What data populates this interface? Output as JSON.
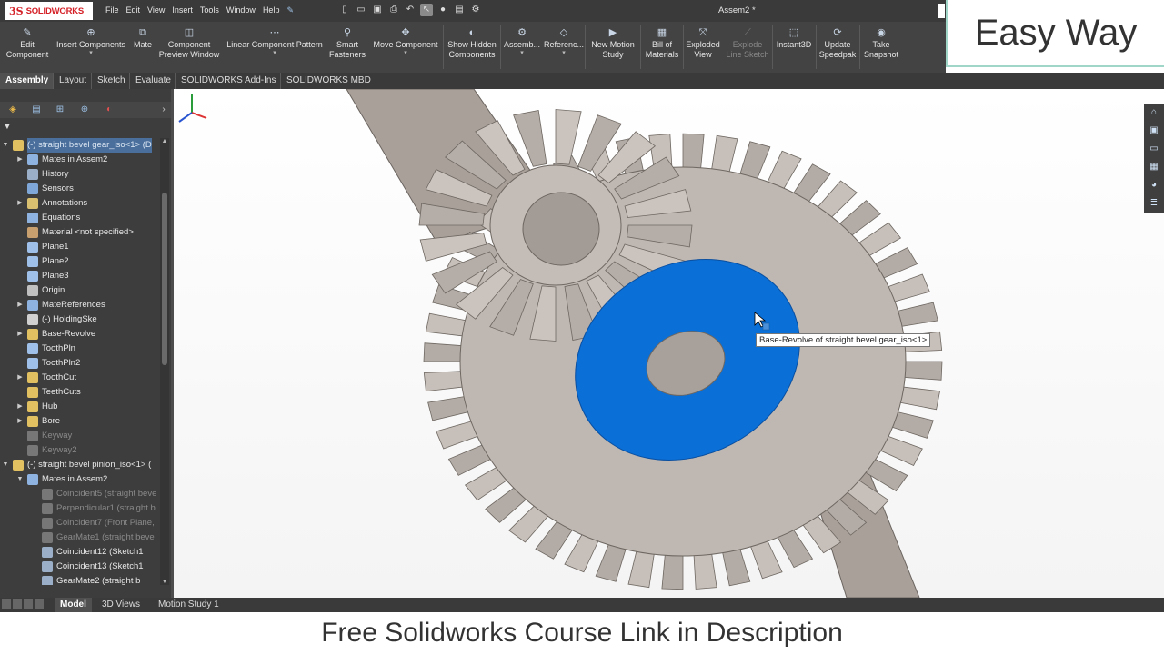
{
  "app": {
    "logo_ds": "3S",
    "logo_name": "SOLIDWORKS",
    "menu": [
      "File",
      "Edit",
      "View",
      "Insert",
      "Tools",
      "Window",
      "Help"
    ],
    "document_title": "Assem2 *"
  },
  "overlay": {
    "brand_text": "Easy Way",
    "caption": "Free Solidworks Course Link in Description"
  },
  "ribbon": {
    "buttons": [
      {
        "label": "Edit\nComponent",
        "icon": "edit-component-icon"
      },
      {
        "label": "Insert Components",
        "icon": "insert-components-icon"
      },
      {
        "label": "Mate",
        "icon": "mate-icon"
      },
      {
        "label": "Component\nPreview Window",
        "icon": "preview-window-icon"
      },
      {
        "label": "Linear Component Pattern",
        "icon": "linear-pattern-icon"
      },
      {
        "label": "Smart\nFasteners",
        "icon": "smart-fasteners-icon"
      },
      {
        "label": "Move Component",
        "icon": "move-component-icon"
      },
      {
        "label": "Show Hidden\nComponents",
        "icon": "show-hidden-icon"
      },
      {
        "label": "Assemb...",
        "icon": "assembly-features-icon"
      },
      {
        "label": "Referenc...",
        "icon": "reference-geometry-icon"
      },
      {
        "label": "New Motion\nStudy",
        "icon": "motion-study-icon"
      },
      {
        "label": "Bill of\nMaterials",
        "icon": "bom-icon"
      },
      {
        "label": "Exploded\nView",
        "icon": "exploded-view-icon"
      },
      {
        "label": "Explode\nLine Sketch",
        "icon": "explode-line-icon"
      },
      {
        "label": "Instant3D",
        "icon": "instant3d-icon"
      },
      {
        "label": "Update\nSpeedpak",
        "icon": "speedpak-icon"
      },
      {
        "label": "Take\nSnapshot",
        "icon": "snapshot-icon"
      }
    ]
  },
  "tabs": [
    "Assembly",
    "Layout",
    "Sketch",
    "Evaluate",
    "SOLIDWORKS Add-Ins",
    "SOLIDWORKS MBD"
  ],
  "active_tab": "Assembly",
  "tree": [
    {
      "label": "(-) straight bevel gear_iso<1> (D",
      "icon": "part-icon",
      "expand": "▼",
      "selected": true
    },
    {
      "label": "Mates in Assem2",
      "icon": "mates-folder-icon",
      "expand": "▶"
    },
    {
      "label": "History",
      "icon": "history-icon",
      "expand": ""
    },
    {
      "label": "Sensors",
      "icon": "sensor-icon",
      "expand": ""
    },
    {
      "label": "Annotations",
      "icon": "annotations-icon",
      "expand": "▶"
    },
    {
      "label": "Equations",
      "icon": "equations-icon",
      "expand": ""
    },
    {
      "label": "Material <not specified>",
      "icon": "material-icon",
      "expand": ""
    },
    {
      "label": "Plane1",
      "icon": "plane-icon",
      "expand": ""
    },
    {
      "label": "Plane2",
      "icon": "plane-icon",
      "expand": ""
    },
    {
      "label": "Plane3",
      "icon": "plane-icon",
      "expand": ""
    },
    {
      "label": "Origin",
      "icon": "origin-icon",
      "expand": ""
    },
    {
      "label": "MateReferences",
      "icon": "mate-references-icon",
      "expand": "▶"
    },
    {
      "label": "(-) HoldingSke",
      "icon": "sketch-icon",
      "expand": ""
    },
    {
      "label": "Base-Revolve",
      "icon": "revolve-icon",
      "expand": "▶"
    },
    {
      "label": "ToothPln",
      "icon": "plane-icon",
      "expand": ""
    },
    {
      "label": "ToothPln2",
      "icon": "plane-icon",
      "expand": ""
    },
    {
      "label": "ToothCut",
      "icon": "cut-icon",
      "expand": "▶"
    },
    {
      "label": "TeethCuts",
      "icon": "pattern-icon",
      "expand": ""
    },
    {
      "label": "Hub",
      "icon": "extrude-icon",
      "expand": "▶"
    },
    {
      "label": "Bore",
      "icon": "cut-icon",
      "expand": "▶"
    },
    {
      "label": "Keyway",
      "icon": "cut-icon",
      "expand": "",
      "dim": true
    },
    {
      "label": "Keyway2",
      "icon": "cut-icon",
      "expand": "",
      "dim": true
    },
    {
      "label": "(-) straight bevel pinion_iso<1> (",
      "icon": "part-icon",
      "expand": "▼"
    },
    {
      "label": "Mates in Assem2",
      "icon": "mates-folder-icon",
      "expand": "▼"
    },
    {
      "label": "Coincident5 (straight beve",
      "icon": "coincident-icon",
      "expand": "",
      "dim": true
    },
    {
      "label": "Perpendicular1 (straight b",
      "icon": "perpendicular-icon",
      "expand": "",
      "dim": true
    },
    {
      "label": "Coincident7 (Front Plane,",
      "icon": "coincident-icon",
      "expand": "",
      "dim": true
    },
    {
      "label": "GearMate1 (straight beve",
      "icon": "gear-mate-icon",
      "expand": "",
      "dim": true
    },
    {
      "label": "Coincident12 (Sketch1",
      "icon": "coincident-icon",
      "expand": ""
    },
    {
      "label": "Coincident13 (Sketch1",
      "icon": "coincident-icon",
      "expand": ""
    },
    {
      "label": "GearMate2 (straight b",
      "icon": "gear-mate-icon",
      "expand": ""
    }
  ],
  "viewport": {
    "tooltip": "Base-Revolve of straight bevel gear_iso<1>",
    "highlight_color": "#0a6fd6",
    "gear_color": "#bfb8b2"
  },
  "bottom_tabs": [
    "Model",
    "3D Views",
    "Motion Study 1"
  ],
  "active_bottom_tab": "Model"
}
